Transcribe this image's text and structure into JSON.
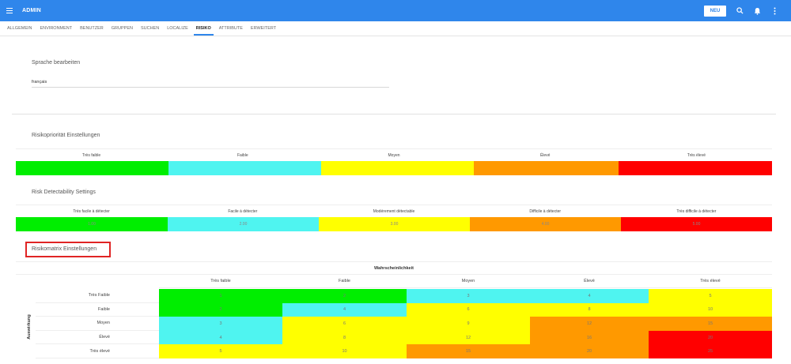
{
  "app": {
    "title": "ADMIN",
    "new_button": "NEU"
  },
  "icons": {
    "menu": "hamburger-icon",
    "search": "search-icon",
    "notifications": "bell-icon",
    "more": "more-vertical-icon"
  },
  "colors": {
    "brand": "#2f86eb",
    "green": "#00ee00",
    "cyan": "#4ff4f0",
    "yellow": "#ffff00",
    "orange": "#ff9900",
    "red": "#ff0000"
  },
  "tabs": [
    {
      "label": "ALLGEMEIN",
      "active": false
    },
    {
      "label": "ENVIRONMENT",
      "active": false
    },
    {
      "label": "BENUTZER",
      "active": false
    },
    {
      "label": "GRUPPEN",
      "active": false
    },
    {
      "label": "SUCHEN",
      "active": false
    },
    {
      "label": "LOCALIZE",
      "active": false
    },
    {
      "label": "RISIKO",
      "active": true
    },
    {
      "label": "ATTRIBUTE",
      "active": false
    },
    {
      "label": "ERWEITERT",
      "active": false
    }
  ],
  "language": {
    "title": "Sprache bearbeiten",
    "value": "français"
  },
  "priority": {
    "title": "Risikopriorität Einstellungen",
    "levels": [
      {
        "label": "Très faible",
        "color": "#00ee00"
      },
      {
        "label": "Faible",
        "color": "#4ff4f0"
      },
      {
        "label": "Moyen",
        "color": "#ffff00"
      },
      {
        "label": "Élevé",
        "color": "#ff9900"
      },
      {
        "label": "Très élevé",
        "color": "#ff0000"
      }
    ]
  },
  "detectability": {
    "title": "Risk Detectability Settings",
    "levels": [
      {
        "label": "Très facile à détecter",
        "value": "1.00",
        "color": "#00ee00"
      },
      {
        "label": "Facile à détecter",
        "value": "2.00",
        "color": "#4ff4f0"
      },
      {
        "label": "Modérement détectable",
        "value": "3.00",
        "color": "#ffff00"
      },
      {
        "label": "Difficile à détecter",
        "value": "4.00",
        "color": "#ff9900"
      },
      {
        "label": "Très difficile à détecter",
        "value": "5.00",
        "color": "#ff0000"
      }
    ]
  },
  "matrix": {
    "title": "Risikomatrix Einstellungen",
    "x_axis": "Wahrscheinlichkeit",
    "y_axis": "Auswirkung",
    "columns": [
      "Très faible",
      "Faible",
      "Moyen",
      "Élevé",
      "Très élevé"
    ],
    "rows": [
      "Très Faible",
      "Faible",
      "Moyen",
      "Élevé",
      "Très élevé"
    ],
    "cells": [
      [
        "1",
        "2",
        "3",
        "4",
        "5"
      ],
      [
        "2",
        "4",
        "6",
        "8",
        "10"
      ],
      [
        "3",
        "6",
        "9",
        "12",
        "15"
      ],
      [
        "4",
        "8",
        "12",
        "16",
        "20"
      ],
      [
        "5",
        "10",
        "15",
        "20",
        "25"
      ]
    ]
  }
}
